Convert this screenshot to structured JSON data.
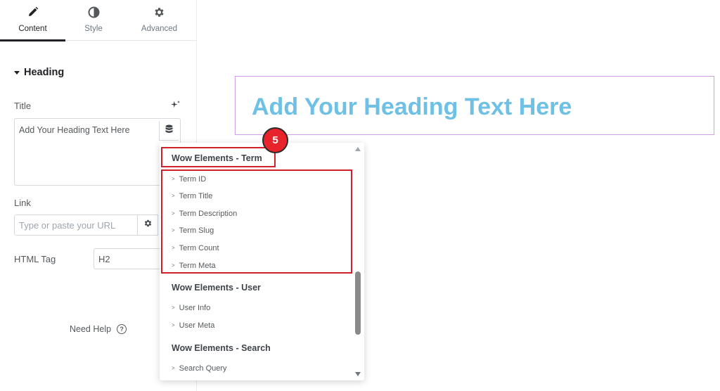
{
  "tabs": [
    {
      "label": "Content",
      "icon": "pencil-icon",
      "active": true
    },
    {
      "label": "Style",
      "icon": "contrast-icon",
      "active": false
    },
    {
      "label": "Advanced",
      "icon": "gear-icon",
      "active": false
    }
  ],
  "section": {
    "title": "Heading"
  },
  "fields": {
    "title_label": "Title",
    "title_value": "Add Your Heading Text Here",
    "link_label": "Link",
    "link_placeholder": "Type or paste your URL",
    "html_tag_label": "HTML Tag",
    "html_tag_value": "H2"
  },
  "help": {
    "label": "Need Help"
  },
  "canvas": {
    "heading": "Add Your Heading Text Here",
    "heading_color": "#6ec1e4"
  },
  "dropdown": {
    "groups": [
      {
        "title": "Wow Elements - Term",
        "items": [
          "Term ID",
          "Term Title",
          "Term Description",
          "Term Slug",
          "Term Count",
          "Term Meta"
        ]
      },
      {
        "title": "Wow Elements - User",
        "items": [
          "User Info",
          "User Meta"
        ]
      },
      {
        "title": "Wow Elements - Search",
        "items": [
          "Search Query"
        ]
      }
    ]
  },
  "annotation": {
    "step": "5",
    "color": "#d0202a"
  }
}
